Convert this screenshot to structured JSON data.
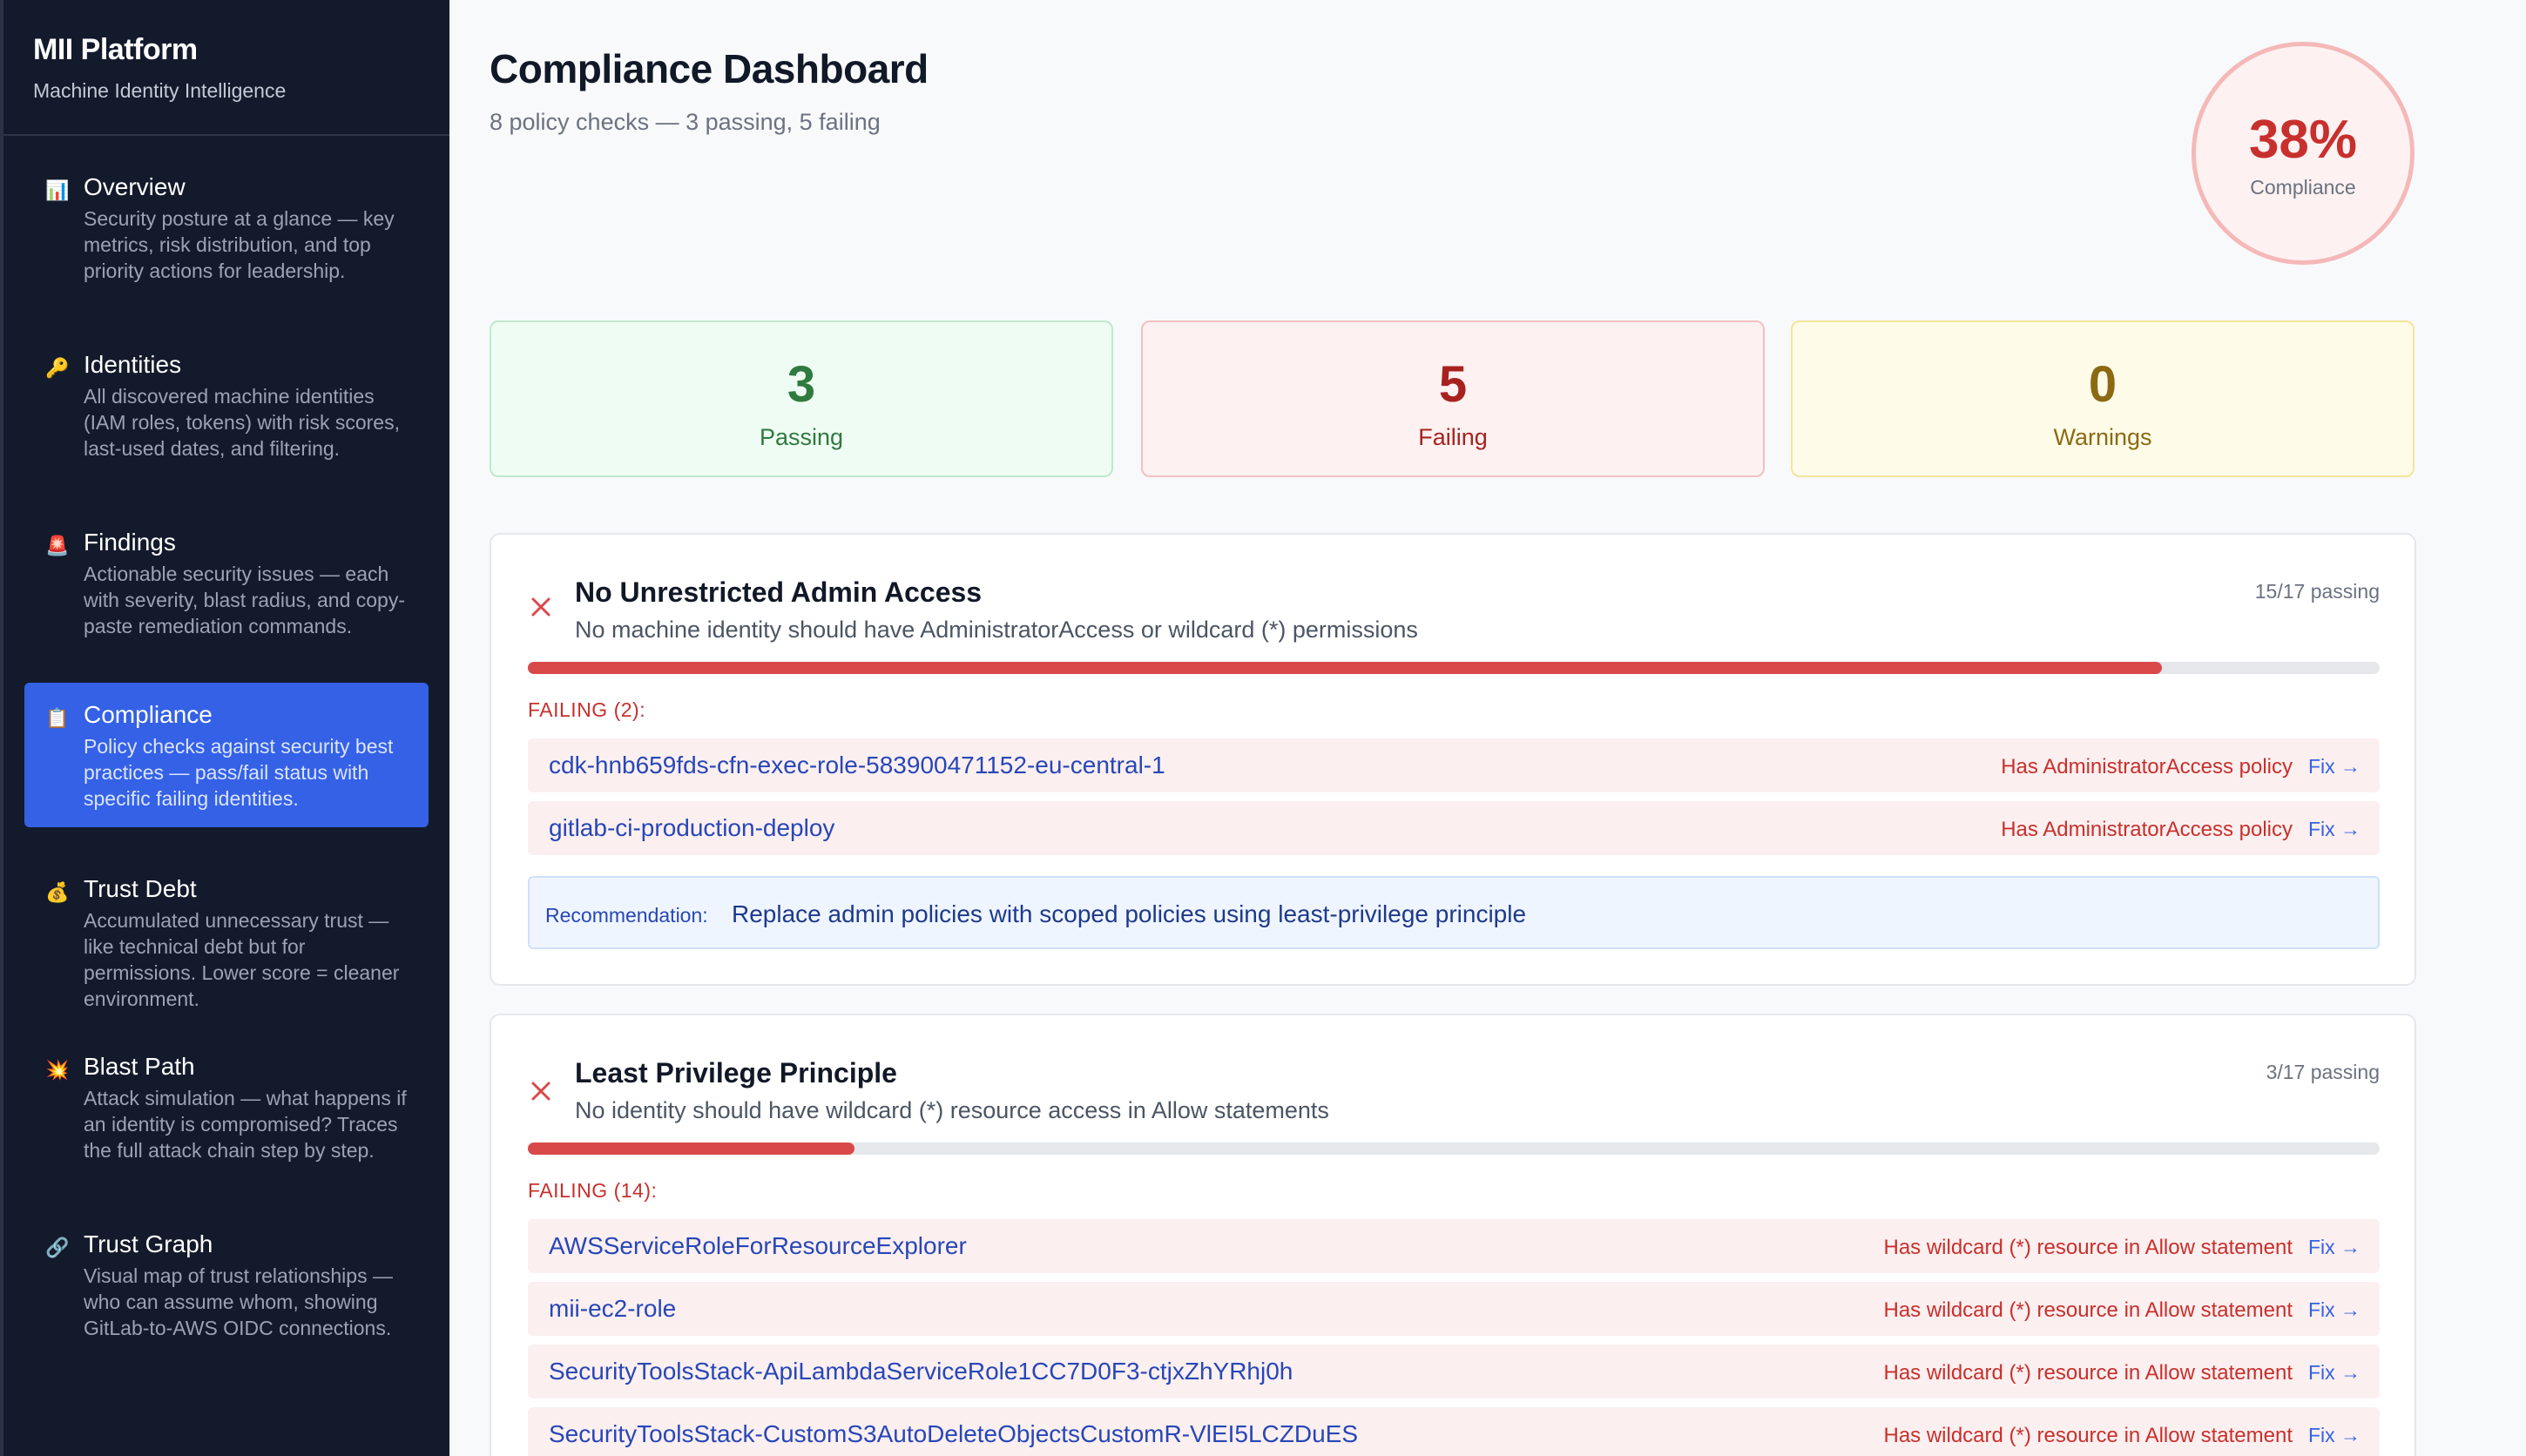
{
  "sidebar": {
    "brand_title": "MII Platform",
    "brand_subtitle": "Machine Identity Intelligence",
    "items": [
      {
        "icon": "bar-chart-icon",
        "glyph": "📊",
        "label": "Overview",
        "desc": "Security posture at a glance — key metrics, risk distribution, and top priority actions for leadership."
      },
      {
        "icon": "key-icon",
        "glyph": "🔑",
        "label": "Identities",
        "desc": "All discovered machine identities (IAM roles, tokens) with risk scores, last-used dates, and filtering."
      },
      {
        "icon": "siren-icon",
        "glyph": "🚨",
        "label": "Findings",
        "desc": "Actionable security issues — each with severity, blast radius, and copy-paste remediation commands."
      },
      {
        "icon": "clipboard-icon",
        "glyph": "📋",
        "label": "Compliance",
        "desc": "Policy checks against security best practices — pass/fail status with specific failing identities."
      },
      {
        "icon": "money-bag-icon",
        "glyph": "💰",
        "label": "Trust Debt",
        "desc": "Accumulated unnecessary trust — like technical debt but for permissions. Lower score = cleaner environment."
      },
      {
        "icon": "explosion-icon",
        "glyph": "💥",
        "label": "Blast Path",
        "desc": "Attack simulation — what happens if an identity is compromised? Traces the full attack chain step by step."
      },
      {
        "icon": "link-icon",
        "glyph": "🔗",
        "label": "Trust Graph",
        "desc": "Visual map of trust relationships — who can assume whom, showing GitLab-to-AWS OIDC connections."
      }
    ],
    "active_index": 3
  },
  "header": {
    "title": "Compliance Dashboard",
    "subtitle": "8 policy checks — 3 passing, 5 failing"
  },
  "score": {
    "value": "38%",
    "label": "Compliance",
    "color": "#c7302d"
  },
  "stats": {
    "passing": {
      "value": "3",
      "label": "Passing"
    },
    "failing": {
      "value": "5",
      "label": "Failing"
    },
    "warnings": {
      "value": "0",
      "label": "Warnings"
    }
  },
  "checks": [
    {
      "title": "No Unrestricted Admin Access",
      "description": "No machine identity should have AdministratorAccess or wildcard (*) permissions",
      "count": "15/17 passing",
      "pass_fraction": 0.8824,
      "failing_label": "FAILING (2):",
      "failures": [
        {
          "identity": "cdk-hnb659fds-cfn-exec-role-583900471152-eu-central-1",
          "reason": "Has AdministratorAccess policy",
          "fix": "Fix →"
        },
        {
          "identity": "gitlab-ci-production-deploy",
          "reason": "Has AdministratorAccess policy",
          "fix": "Fix →"
        }
      ],
      "recommendation_label": "Recommendation:",
      "recommendation": "Replace admin policies with scoped policies using least-privilege principle"
    },
    {
      "title": "Least Privilege Principle",
      "description": "No identity should have wildcard (*) resource access in Allow statements",
      "count": "3/17 passing",
      "pass_fraction": 0.1765,
      "failing_label": "FAILING (14):",
      "failures": [
        {
          "identity": "AWSServiceRoleForResourceExplorer",
          "reason": "Has wildcard (*) resource in Allow statement",
          "fix": "Fix →"
        },
        {
          "identity": "mii-ec2-role",
          "reason": "Has wildcard (*) resource in Allow statement",
          "fix": "Fix →"
        },
        {
          "identity": "SecurityToolsStack-ApiLambdaServiceRole1CC7D0F3-ctjxZhYRhj0h",
          "reason": "Has wildcard (*) resource in Allow statement",
          "fix": "Fix →"
        },
        {
          "identity": "SecurityToolsStack-CustomS3AutoDeleteObjectsCustomR-VlEI5LCZDuES",
          "reason": "Has wildcard (*) resource in Allow statement",
          "fix": "Fix →"
        }
      ]
    }
  ]
}
